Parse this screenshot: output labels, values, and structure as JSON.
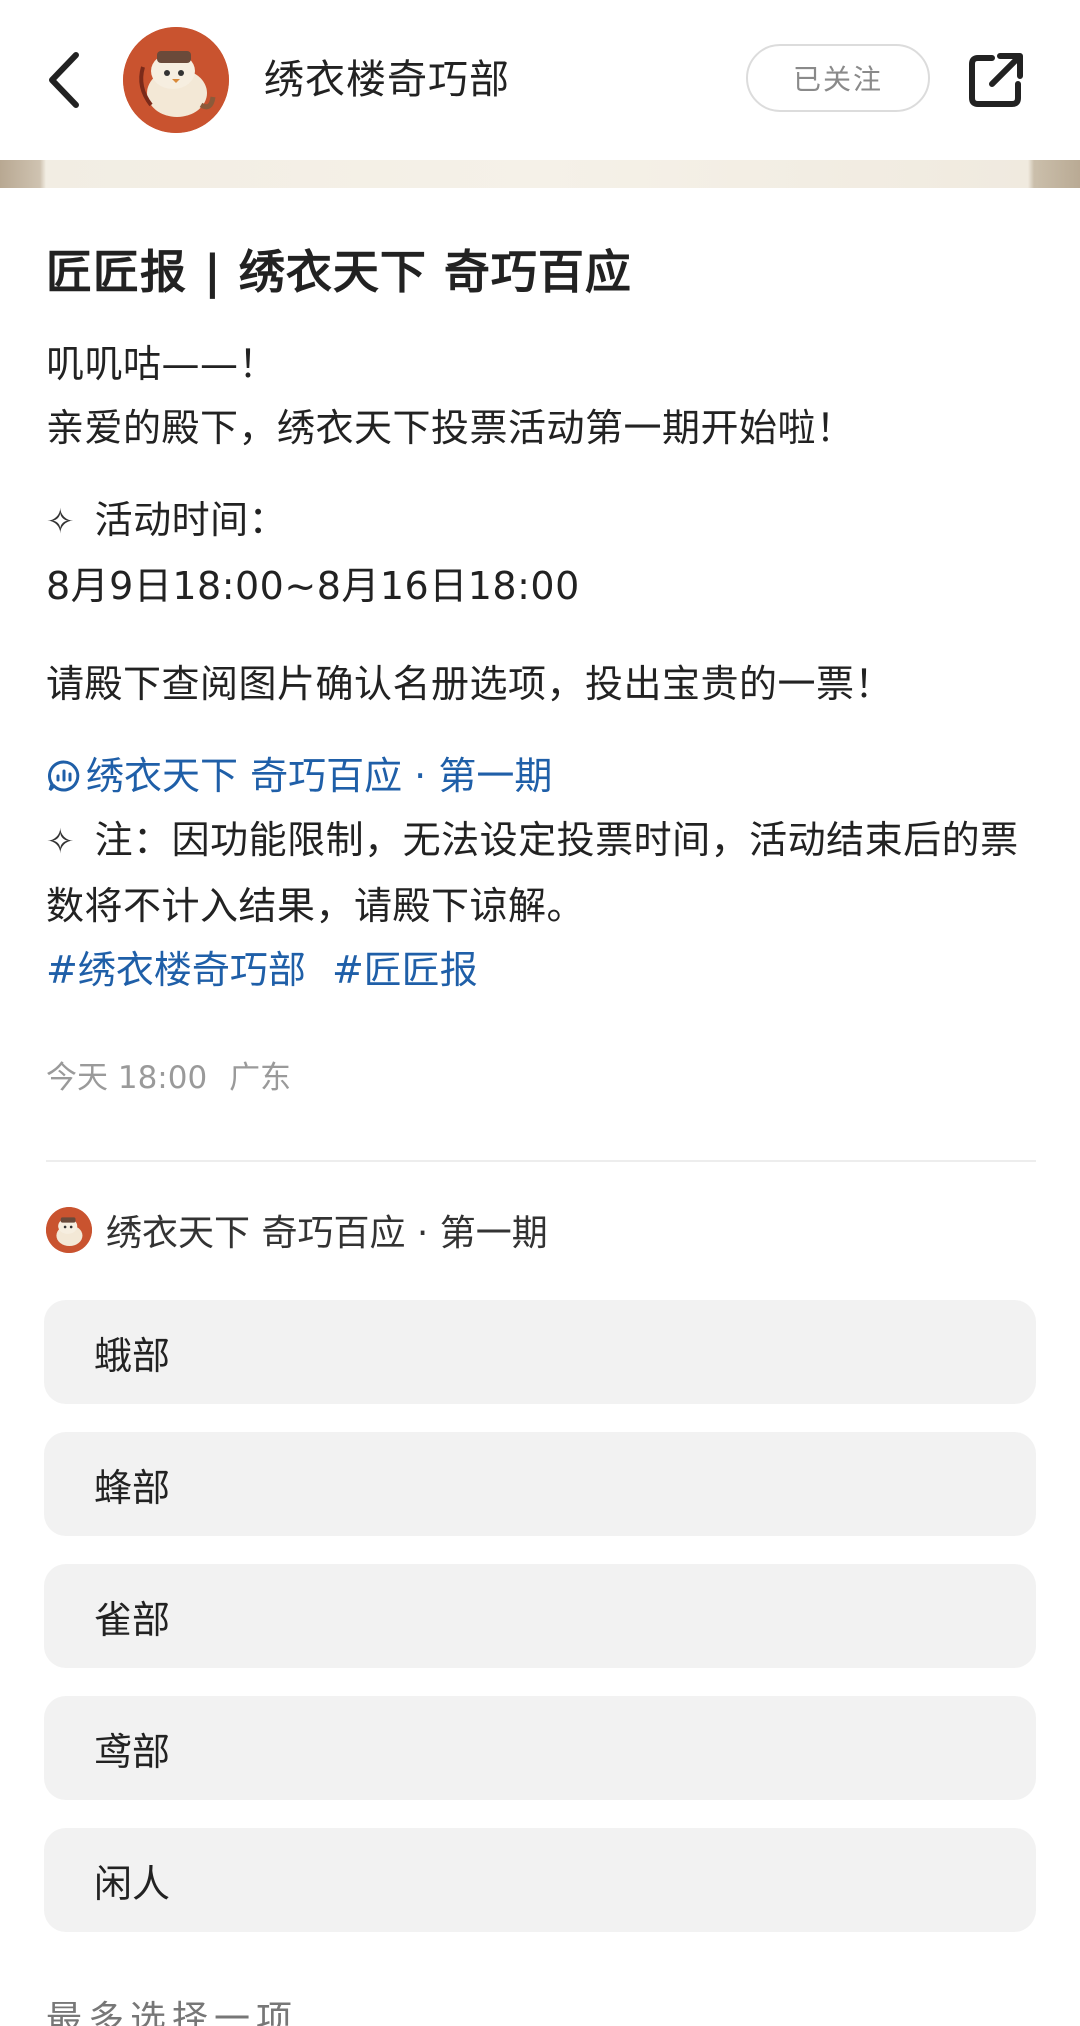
{
  "header": {
    "account_name": "绣衣楼奇巧部",
    "follow_label": "已关注"
  },
  "post": {
    "title": "匠匠报 | 绣衣天下 奇巧百应",
    "line1": "叽叽咕——！",
    "line2": "亲爱的殿下，绣衣天下投票活动第一期开始啦！",
    "time_label": "活动时间：",
    "time_value": "8月9日18:00~8月16日18:00",
    "instruction": "请殿下查阅图片确认名册选项，投出宝贵的一票！",
    "vote_link": "绣衣天下 奇巧百应 · 第一期",
    "note": "注：因功能限制，无法设定投票时间，活动结束后的票数将不计入结果，请殿下谅解。",
    "tags": [
      "#绣衣楼奇巧部",
      "#匠匠报"
    ],
    "meta_time": "今天 18:00",
    "meta_location": "广东"
  },
  "poll": {
    "title": "绣衣天下 奇巧百应 · 第一期",
    "options": [
      "蛾部",
      "蜂部",
      "雀部",
      "鸢部",
      "闲人"
    ]
  },
  "footer": {
    "cutoff_text": "最多选择一项"
  },
  "colors": {
    "link": "#1f5fa8",
    "avatar_bg": "#c9532f",
    "option_bg": "#f2f2f2"
  }
}
